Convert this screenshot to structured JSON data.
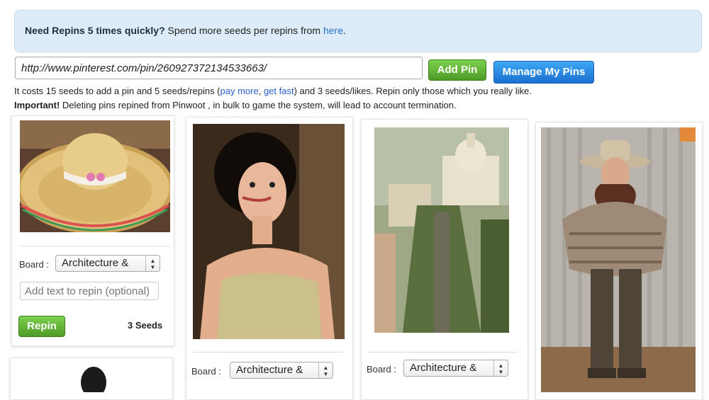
{
  "notice": {
    "bold_text": "Need Repins 5 times quickly?",
    "text": " Spend more seeds per repins from ",
    "link": "here",
    "end": "."
  },
  "pin_form": {
    "url_value": "http://www.pinterest.com/pin/260927372134533663/",
    "add_pin_label": "Add Pin",
    "manage_label": "Manage My Pins"
  },
  "info": {
    "line1_a": "It costs 15 seeds to add a pin and 5 seeds/repins (",
    "pay_more": "pay more",
    "sep": ", ",
    "get_fast": "get fast",
    "line1_b": ") and 3 seeds/likes. Repin only those which you really like.",
    "important": "Important!",
    "line2": " Deleting pins repined from Pinwoot , in bulk to game the system, will lead to account termination."
  },
  "cards": [
    {
      "board_label": "Board :",
      "board_value": "Architecture &",
      "repin_placeholder": "Add text to repin (optional)",
      "repin_label": "Repin",
      "seeds": "3 Seeds"
    },
    {
      "board_label": "Board :",
      "board_value": "Architecture &"
    },
    {
      "board_label": "Board :",
      "board_value": "Architecture &"
    }
  ],
  "colors": {
    "notice_bg": "#ddecf8",
    "green_button": "#5cb030",
    "blue_button": "#2a8be6",
    "link": "#2a5fcf"
  }
}
